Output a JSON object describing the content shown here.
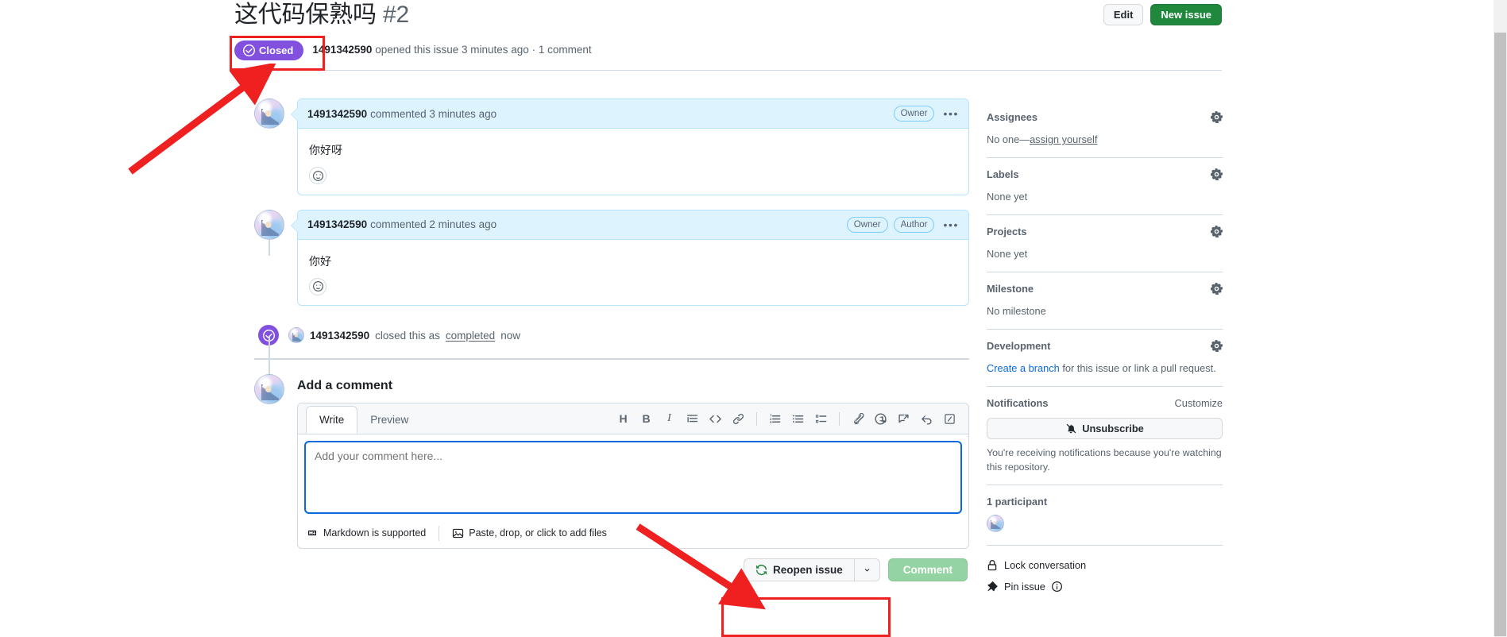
{
  "header": {
    "title": "这代码保熟吗",
    "number": "#2",
    "edit_label": "Edit",
    "new_issue_label": "New issue",
    "state": "Closed",
    "meta_author": "1491342590",
    "meta_text": " opened this issue 3 minutes ago · 1 comment"
  },
  "comments": [
    {
      "author": "1491342590",
      "meta": "commented 3 minutes ago",
      "badges": [
        "Owner"
      ],
      "body": "你好呀",
      "kebab": "•••",
      "reaction_icon": "smiley-icon"
    },
    {
      "author": "1491342590",
      "meta": "commented 2 minutes ago",
      "badges": [
        "Owner",
        "Author"
      ],
      "body": "你好",
      "kebab": "•••",
      "reaction_icon": "smiley-icon"
    }
  ],
  "event": {
    "actor": "1491342590",
    "text_before": "closed this as",
    "link": "completed",
    "text_after": "now"
  },
  "composer": {
    "heading": "Add a comment",
    "tab_write": "Write",
    "tab_preview": "Preview",
    "placeholder": "Add your comment here...",
    "value": "",
    "toolbar": [
      {
        "name": "heading-icon",
        "glyph": "H"
      },
      {
        "name": "bold-icon",
        "glyph": "B"
      },
      {
        "name": "italic-icon",
        "glyph": "I"
      },
      {
        "name": "quote-icon",
        "glyph": "≡"
      },
      {
        "name": "code-icon",
        "glyph": "<>"
      },
      {
        "name": "link-icon",
        "glyph": "🔗"
      },
      {
        "name": "ordered-list-icon",
        "glyph": "1."
      },
      {
        "name": "unordered-list-icon",
        "glyph": "•"
      },
      {
        "name": "task-list-icon",
        "glyph": "☑"
      },
      {
        "name": "attachment-icon",
        "glyph": "📎"
      },
      {
        "name": "mention-icon",
        "glyph": "@"
      },
      {
        "name": "reference-icon",
        "glyph": "⤴"
      },
      {
        "name": "reply-icon",
        "glyph": "↰"
      },
      {
        "name": "slash-command-icon",
        "glyph": "/"
      }
    ],
    "markdown_note": "Markdown is supported",
    "paste_note": "Paste, drop, or click to add files",
    "reopen_label": "Reopen issue",
    "comment_label": "Comment"
  },
  "sidebar": {
    "assignees": {
      "title": "Assignees",
      "value_prefix": "No one—",
      "value_link": "assign yourself"
    },
    "labels": {
      "title": "Labels",
      "value": "None yet"
    },
    "projects": {
      "title": "Projects",
      "value": "None yet"
    },
    "milestone": {
      "title": "Milestone",
      "value": "No milestone"
    },
    "development": {
      "title": "Development",
      "link": "Create a branch",
      "rest": " for this issue or link a pull request."
    },
    "notifications": {
      "title": "Notifications",
      "customize": "Customize",
      "button": "Unsubscribe",
      "note": "You're receiving notifications because you're watching this repository."
    },
    "participants": {
      "title": "1 participant"
    },
    "lock": "Lock conversation",
    "pin": "Pin issue"
  },
  "colors": {
    "closed_purple": "#8250df",
    "green": "#1f883d",
    "link_blue": "#0969da",
    "comment_head_blue": "#ddf4ff",
    "annotation_red": "#ee2020"
  }
}
